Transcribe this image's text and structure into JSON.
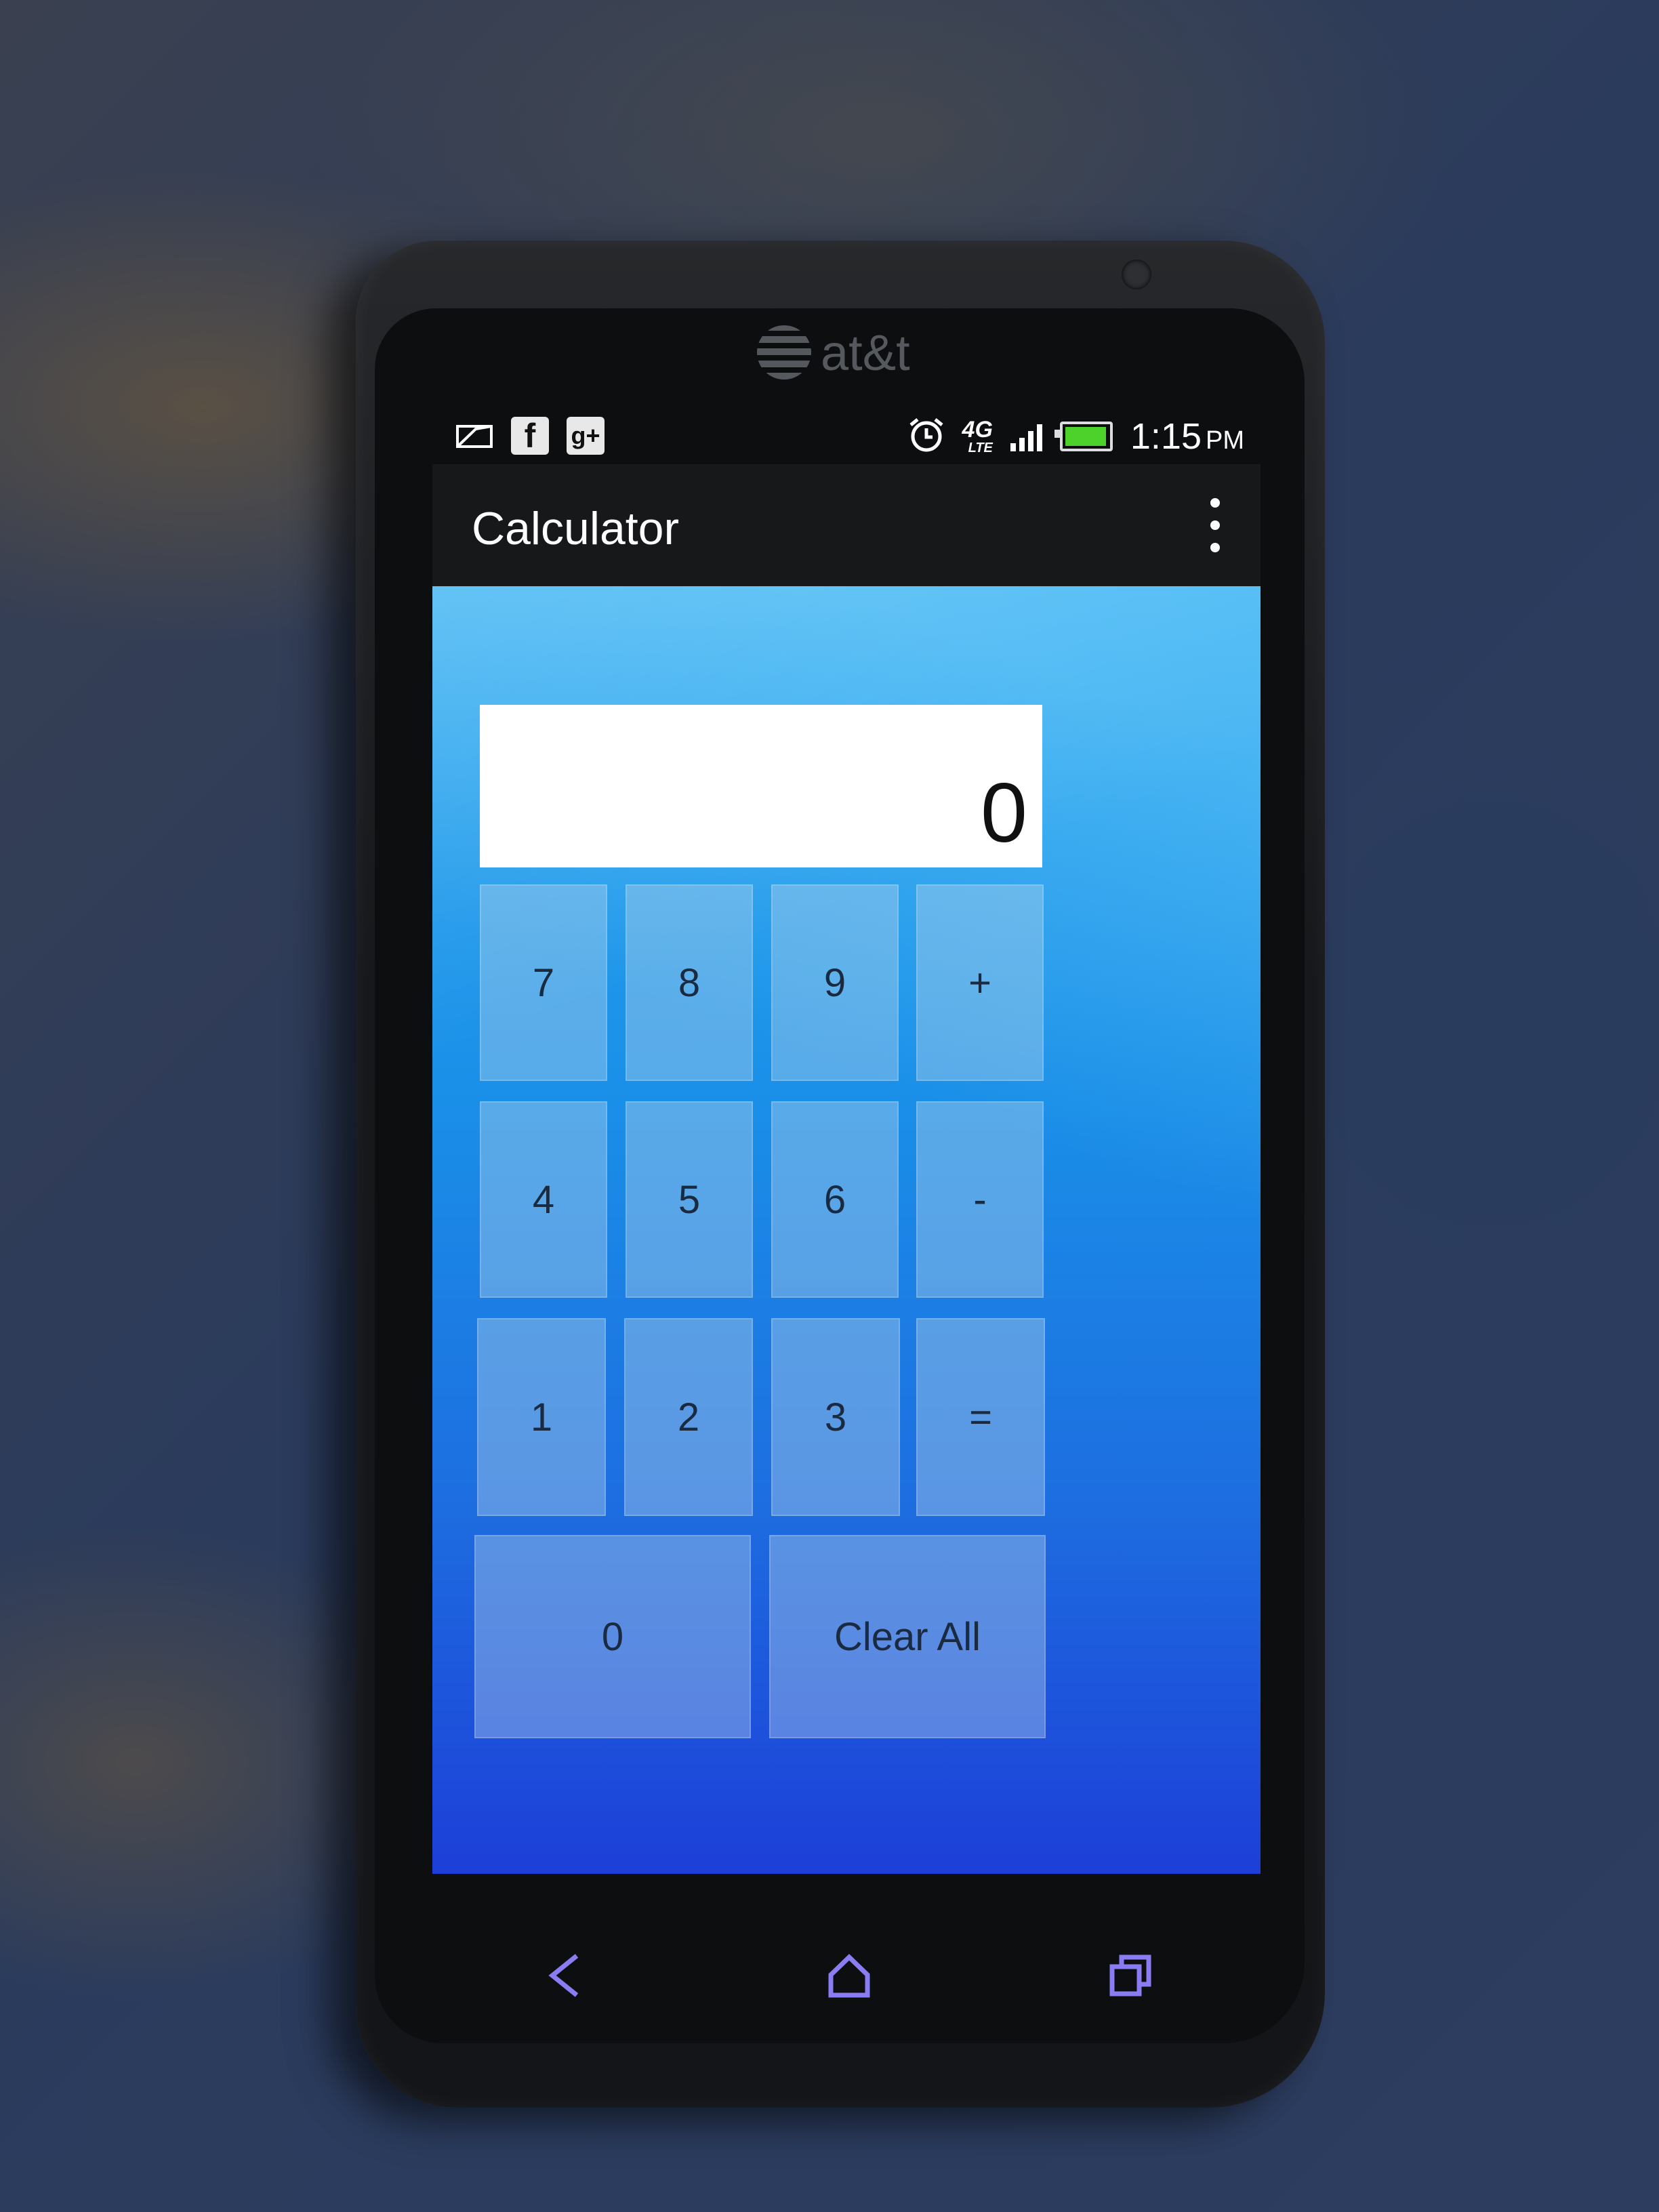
{
  "device": {
    "brand": "at&t"
  },
  "status_bar": {
    "time": "1:15",
    "ampm": "PM",
    "network": "4G",
    "network_sub": "LTE",
    "notification_icons": [
      "message-icon",
      "facebook-icon",
      "google-plus-icon"
    ],
    "status_icons": [
      "alarm-icon",
      "4g-lte-icon",
      "signal-icon",
      "battery-icon"
    ],
    "battery_level": 0.85,
    "signal_bars": 4
  },
  "action_bar": {
    "title": "Calculator",
    "menu_icon": "overflow-menu-icon"
  },
  "calculator": {
    "display_value": "0",
    "keys": {
      "k7": "7",
      "k8": "8",
      "k9": "9",
      "plus": "+",
      "k4": "4",
      "k5": "5",
      "k6": "6",
      "minus": "-",
      "k1": "1",
      "k2": "2",
      "k3": "3",
      "equals": "=",
      "k0": "0",
      "clear": "Clear All"
    }
  },
  "nav_bar": {
    "icons": [
      "back-icon",
      "home-icon",
      "recent-apps-icon"
    ]
  },
  "colors": {
    "accent_blue": "#1a8fe8",
    "nav_icon": "#8a7cf2",
    "battery_green": "#4cd22a"
  }
}
